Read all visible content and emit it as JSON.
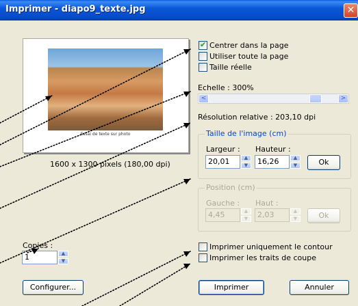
{
  "window": {
    "title": "Imprimer - diapo9_texte.jpg",
    "close_glyph": "✕"
  },
  "preview": {
    "caption": "Essai de texte sur photo",
    "dimensions": "1600 x 1300 pixels (180,00 dpi)"
  },
  "options": {
    "center": {
      "label": "Centrer dans la page",
      "checked": true
    },
    "full_page": {
      "label": "Utiliser toute la page",
      "checked": false
    },
    "actual_size": {
      "label": "Taille réelle",
      "checked": false
    }
  },
  "scale": {
    "label": "Echelle : 300%",
    "value_percent": 300,
    "left_arrow": "<",
    "right_arrow": ">"
  },
  "resolution": {
    "label": "Résolution relative : 203,10 dpi"
  },
  "image_size": {
    "legend": "Taille de l'image (cm)",
    "width_label": "Largeur :",
    "width_value": "20,01",
    "height_label": "Hauteur :",
    "height_value": "16,26",
    "ok_label": "Ok"
  },
  "position": {
    "legend": "Position (cm)",
    "left_label": "Gauche :",
    "left_value": "4,45",
    "top_label": "Haut :",
    "top_value": "2,03",
    "ok_label": "Ok"
  },
  "copies": {
    "label": "Copies :",
    "value": "1"
  },
  "print_options": {
    "contour": {
      "label": "Imprimer uniquement le contour",
      "checked": false
    },
    "cut_marks": {
      "label": "Imprimer les traits de coupe",
      "checked": false
    }
  },
  "buttons": {
    "configure": "Configurer...",
    "print": "Imprimer",
    "cancel": "Annuler"
  },
  "icons": {
    "spin_up": "▲",
    "spin_down": "▼"
  }
}
